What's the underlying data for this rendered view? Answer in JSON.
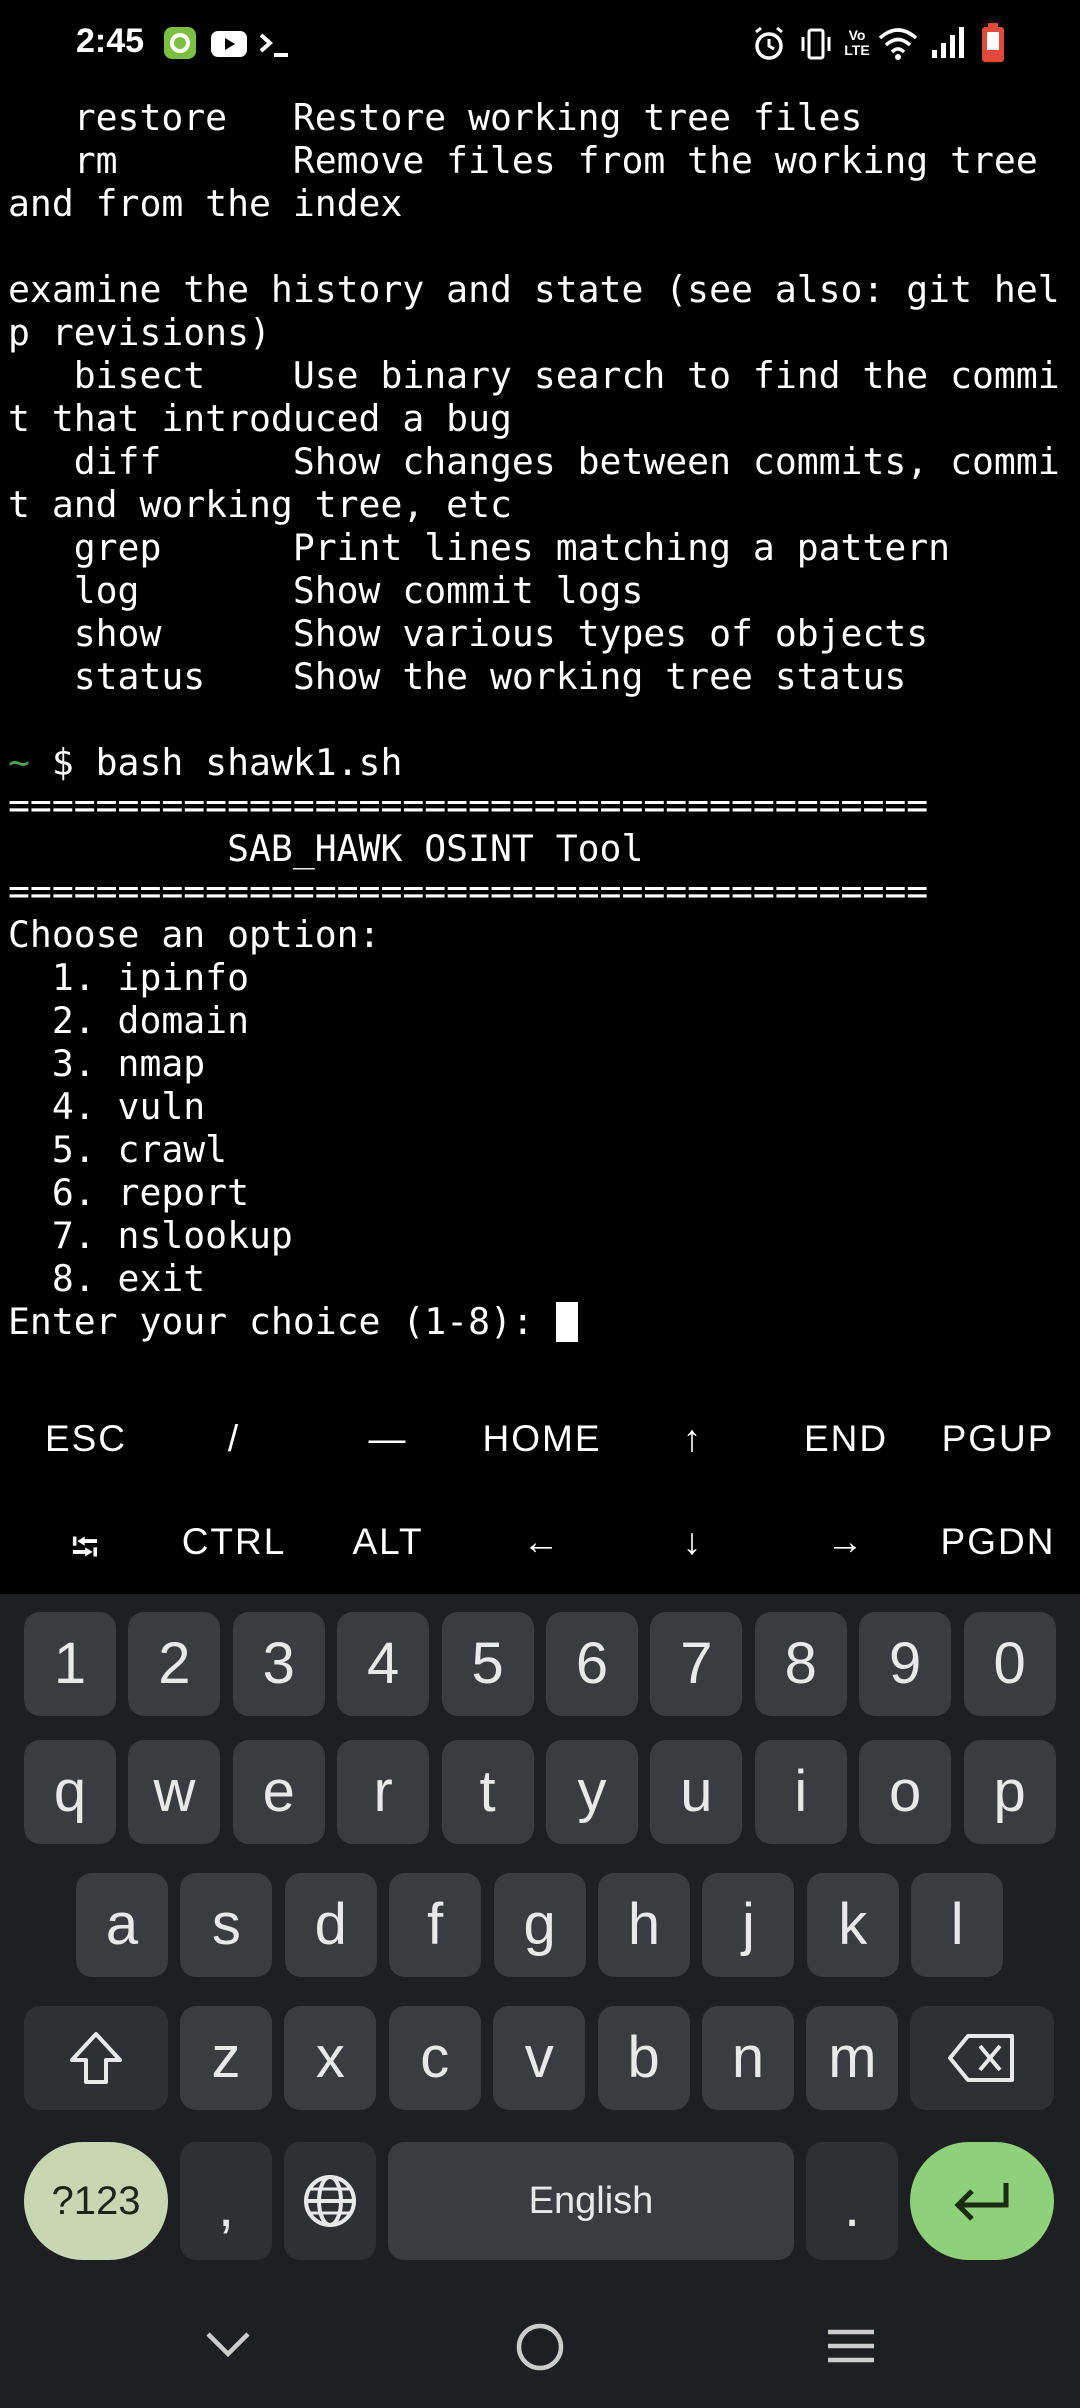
{
  "status_bar": {
    "time": "2:45",
    "icons": [
      "sync-app-icon",
      "youtube-icon",
      "terminal-icon",
      "alarm-icon",
      "vibrate-icon",
      "volte-icon",
      "wifi-icon",
      "signal-icon",
      "battery-low-icon"
    ],
    "volte_label": "Vo LTE"
  },
  "terminal": {
    "lines": [
      "   restore   Restore working tree files",
      "   rm        Remove files from the working tree",
      "and from the index",
      "",
      "examine the history and state (see also: git hel",
      "p revisions)",
      "   bisect    Use binary search to find the commi",
      "t that introduced a bug",
      "   diff      Show changes between commits, commi",
      "t and working tree, etc",
      "   grep      Print lines matching a pattern",
      "   log       Show commit logs",
      "   show      Show various types of objects",
      "   status    Show the working tree status",
      ""
    ],
    "prompt_symbol": "~",
    "prompt_command": " $ bash shawk1.sh",
    "output_lines": [
      "==========================================",
      "          SAB_HAWK OSINT Tool",
      "==========================================",
      "Choose an option:",
      "  1. ipinfo",
      "  2. domain",
      "  3. nmap",
      "  4. vuln",
      "  5. crawl",
      "  6. report",
      "  7. nslookup",
      "  8. exit"
    ],
    "input_prompt": "Enter your choice (1-8): "
  },
  "extra_keys": {
    "row1": [
      "ESC",
      "/",
      "—",
      "HOME",
      "↑",
      "END",
      "PGUP"
    ],
    "row2": [
      "⭾",
      "CTRL",
      "ALT",
      "←",
      "↓",
      "→",
      "PGDN"
    ]
  },
  "keyboard": {
    "numbers": [
      "1",
      "2",
      "3",
      "4",
      "5",
      "6",
      "7",
      "8",
      "9",
      "0"
    ],
    "row_q": [
      "q",
      "w",
      "e",
      "r",
      "t",
      "y",
      "u",
      "i",
      "o",
      "p"
    ],
    "row_a": [
      "a",
      "s",
      "d",
      "f",
      "g",
      "h",
      "j",
      "k",
      "l"
    ],
    "row_z": [
      "z",
      "x",
      "c",
      "v",
      "b",
      "n",
      "m"
    ],
    "symbols_key": "?123",
    "comma_key": ",",
    "space_label": "English",
    "period_key": ".",
    "colors": {
      "enter": "#8fd07a",
      "symbols": "#c8d6b4",
      "key": "#3b3c40",
      "background": "#1e1f22"
    }
  },
  "nav_bar": {
    "icons": [
      "chevron-down-icon",
      "home-circle-icon",
      "menu-icon"
    ]
  }
}
